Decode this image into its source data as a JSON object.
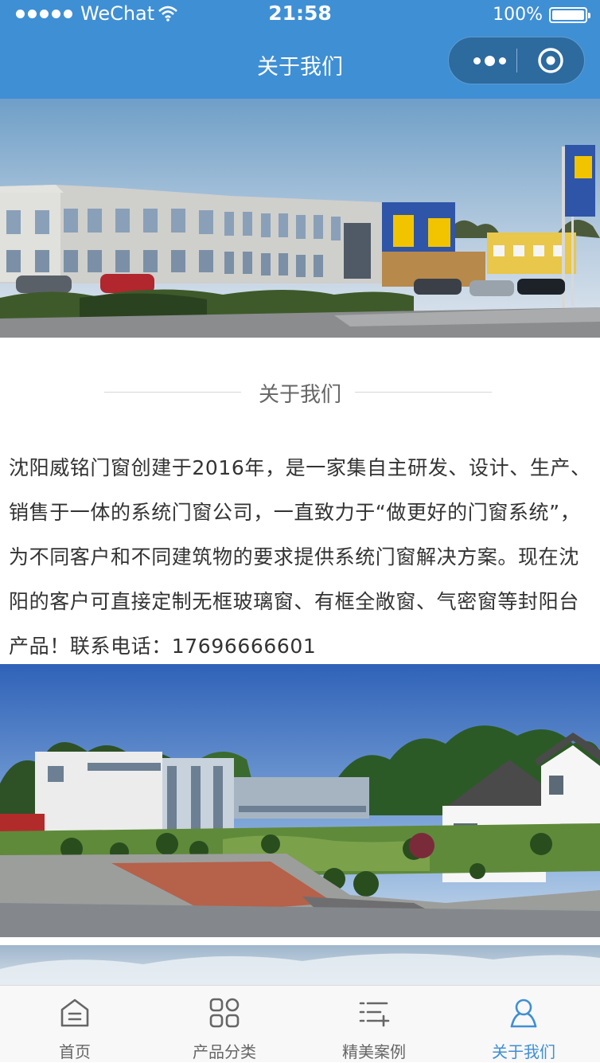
{
  "status_bar": {
    "carrier": "WeChat",
    "time": "21:58",
    "battery": "100%"
  },
  "nav": {
    "title": "关于我们"
  },
  "about": {
    "heading": "关于我们",
    "paragraph": "沈阳威铭门窗创建于2016年，是一家集自主研发、设计、生产、销售于一体的系统门窗公司，一直致力于“做更好的门窗系统”，为不同客户和不同建筑物的要求提供系统门窗解决方案。现在沈阳的客户可直接定制无框玻璃窗、有框全敞窗、气密窗等封阳台产品！联系电话：17696666601"
  },
  "tabs": [
    {
      "label": "首页",
      "icon": "home-icon"
    },
    {
      "label": "产品分类",
      "icon": "grid-icon"
    },
    {
      "label": "精美案例",
      "icon": "list-add-icon"
    },
    {
      "label": "关于我们",
      "icon": "person-icon",
      "active": true
    }
  ],
  "colors": {
    "accent": "#3f8fd4",
    "tab_inactive": "#666666",
    "text": "#333333"
  }
}
